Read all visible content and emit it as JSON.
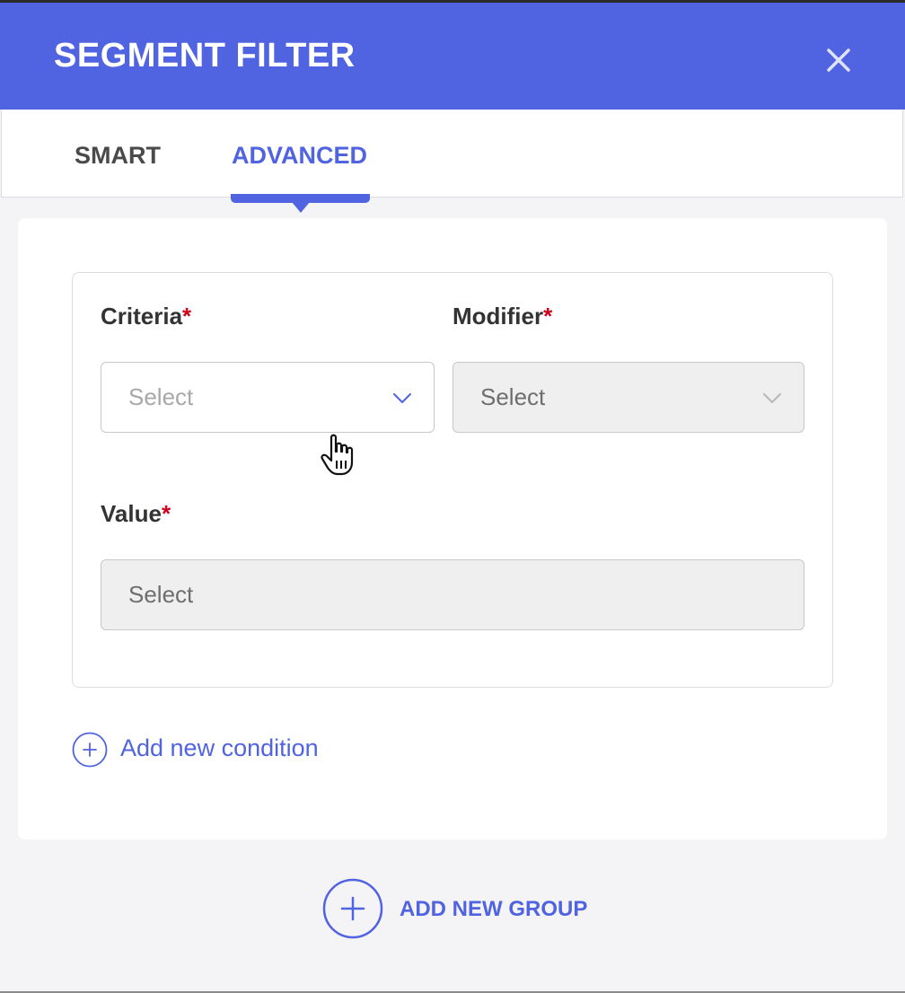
{
  "header": {
    "title": "SEGMENT FILTER",
    "close_icon": "close-icon"
  },
  "tabs": [
    {
      "label": "SMART",
      "active": false
    },
    {
      "label": "ADVANCED",
      "active": true
    }
  ],
  "condition": {
    "criteria": {
      "label": "Criteria",
      "required_mark": "*",
      "placeholder": "Select",
      "enabled": true
    },
    "modifier": {
      "label": "Modifier",
      "required_mark": "*",
      "placeholder": "Select",
      "enabled": false
    },
    "value": {
      "label": "Value",
      "required_mark": "*",
      "placeholder": "Select",
      "enabled": false
    }
  },
  "actions": {
    "add_condition_label": "Add new condition",
    "add_group_label": "ADD NEW GROUP"
  },
  "colors": {
    "accent": "#5063e0",
    "required": "#d0021b",
    "disabled_field": "#efefef"
  }
}
